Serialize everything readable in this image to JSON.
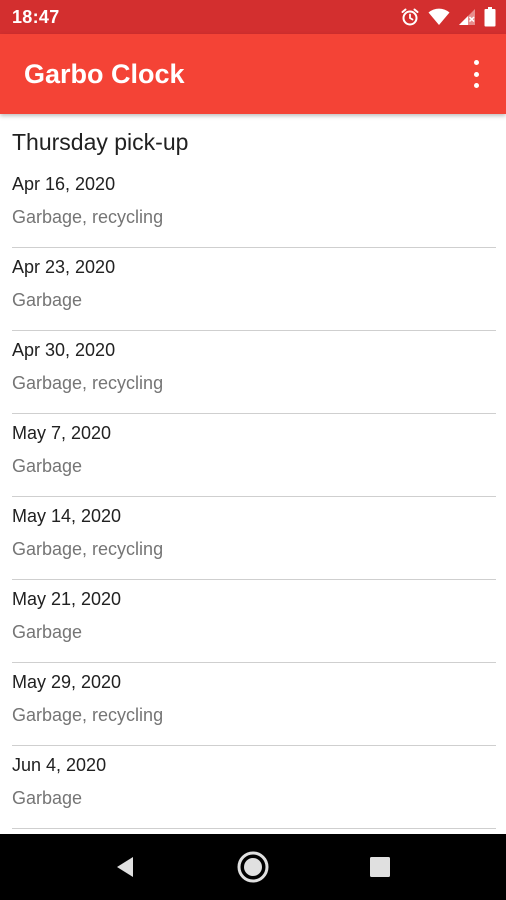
{
  "status_bar": {
    "time": "18:47",
    "icons": [
      "alarm-icon",
      "wifi-icon",
      "signal-icon",
      "battery-icon"
    ],
    "background": "#d32f2f"
  },
  "app_bar": {
    "title": "Garbo Clock",
    "menu_icon": "more-vert-icon",
    "background": "#f44336"
  },
  "schedule": {
    "title": "Thursday pick-up",
    "items": [
      {
        "date": "Apr 16, 2020",
        "type": "Garbage, recycling"
      },
      {
        "date": "Apr 23, 2020",
        "type": "Garbage"
      },
      {
        "date": "Apr 30, 2020",
        "type": "Garbage, recycling"
      },
      {
        "date": "May 7, 2020",
        "type": "Garbage"
      },
      {
        "date": "May 14, 2020",
        "type": "Garbage, recycling"
      },
      {
        "date": "May 21, 2020",
        "type": "Garbage"
      },
      {
        "date": "May 29, 2020",
        "type": "Garbage, recycling"
      },
      {
        "date": "Jun 4, 2020",
        "type": "Garbage"
      }
    ]
  },
  "nav_bar": {
    "buttons": [
      "back-icon",
      "home-icon",
      "recents-icon"
    ]
  }
}
